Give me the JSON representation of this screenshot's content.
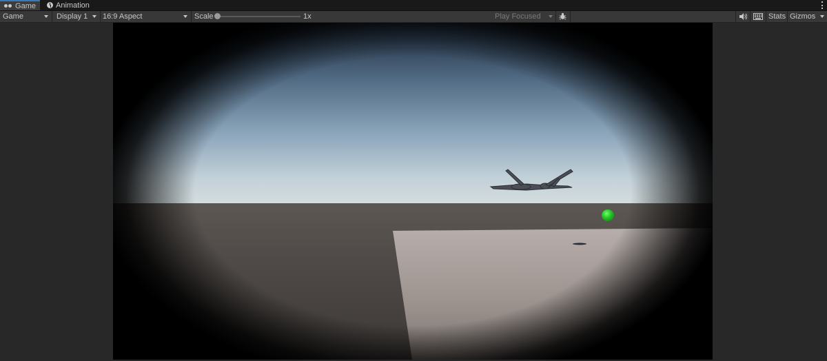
{
  "tabs": [
    {
      "label": "Game",
      "icon": "vr-glasses-icon",
      "active": true
    },
    {
      "label": "Animation",
      "icon": "clock-icon",
      "active": false
    }
  ],
  "toolbar": {
    "view_select": "Game",
    "display_select": "Display 1",
    "aspect_select": "16:9 Aspect",
    "scale_label": "Scale",
    "scale_value": "1x",
    "play_mode": "Play Focused",
    "stats_label": "Stats",
    "gizmos_label": "Gizmos"
  },
  "colors": {
    "accent": "#3a79bb",
    "panel": "#282828",
    "ball": "#22c022"
  }
}
